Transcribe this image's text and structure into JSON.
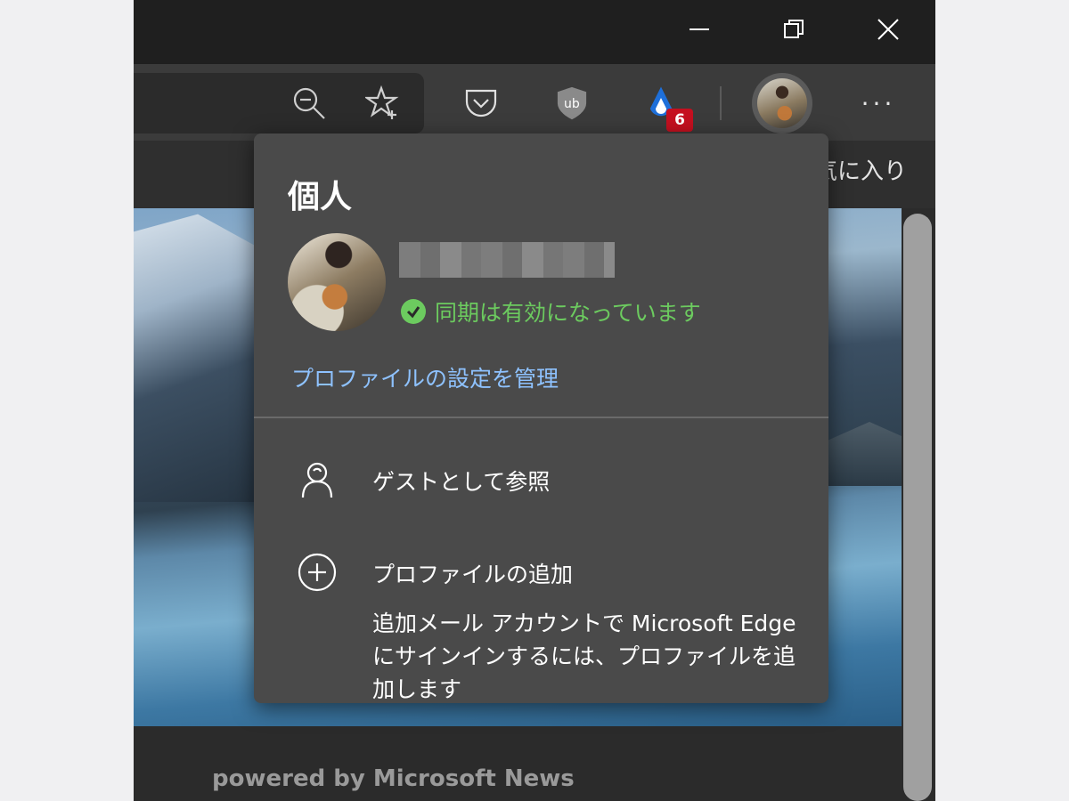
{
  "window": {
    "minimize_icon": "minimize-icon",
    "restore_icon": "restore-icon",
    "close_icon": "close-icon"
  },
  "toolbar": {
    "zoom_icon": "zoom-out-icon",
    "favorite_icon": "add-favorite-star-icon",
    "pocket_icon": "pocket-icon",
    "ublock_icon": "ublock-shield-icon",
    "extension_icon": "droplet-extension-icon",
    "extension_badge": "6",
    "more_label": "···"
  },
  "favorites_bar": {
    "label": "気に入り"
  },
  "profile_flyout": {
    "title": "個人",
    "sync_status": "同期は有効になっています",
    "manage_link": "プロファイルの設定を管理",
    "items": [
      {
        "icon": "guest-person-icon",
        "label": "ゲストとして参照"
      },
      {
        "icon": "add-circle-icon",
        "label": "プロファイルの追加",
        "description": "追加メール アカウントで Microsoft Edge にサインインするには、プロファイルを追加します"
      }
    ]
  },
  "content": {
    "footer": "powered by Microsoft News"
  },
  "colors": {
    "titlebar": "#1f1f1f",
    "toolbar": "#3b3b3b",
    "flyout_bg": "#4a4a4a",
    "sync_green": "#6ccb5f",
    "link_blue": "#8ec2ff",
    "badge_red": "#c50f1f"
  }
}
